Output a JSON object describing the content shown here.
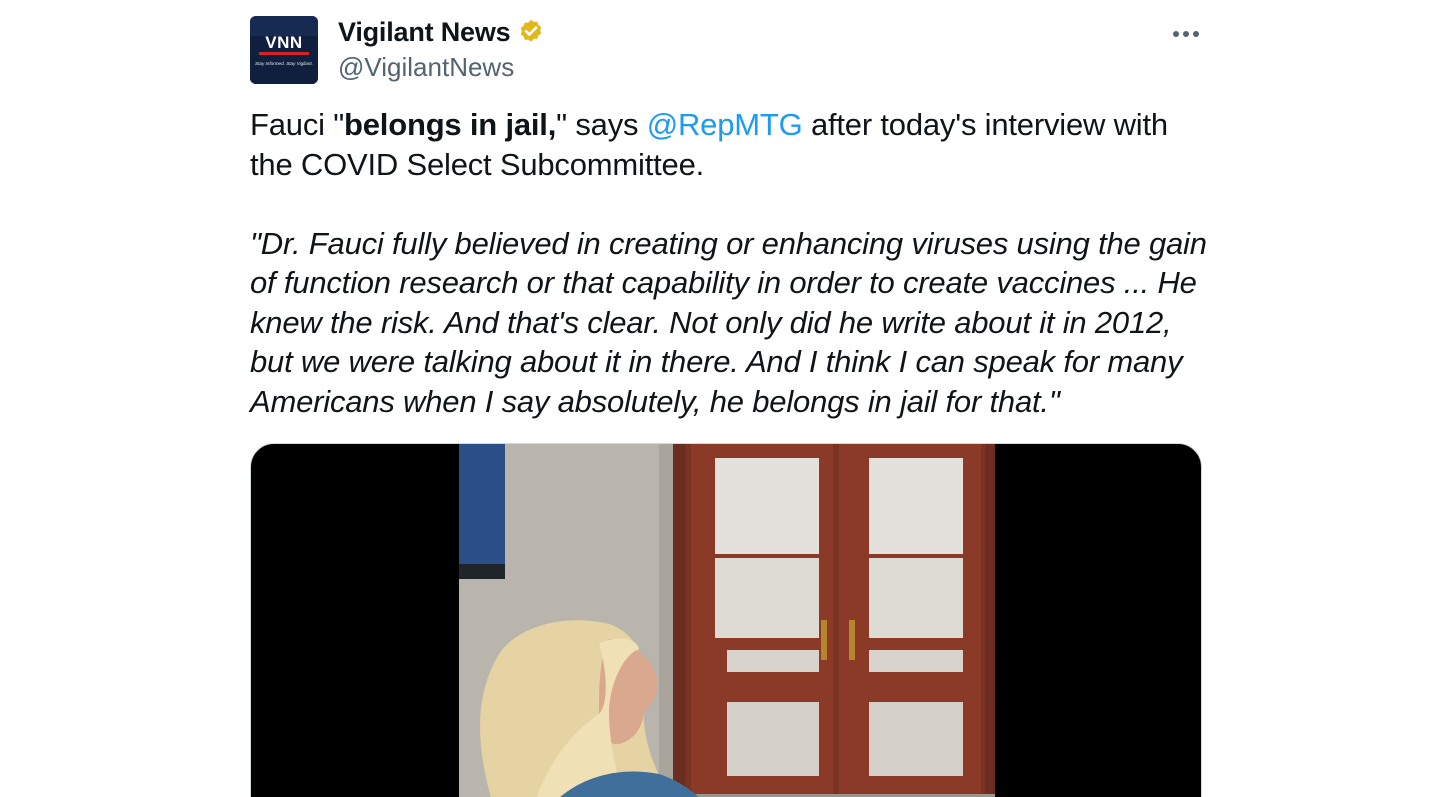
{
  "tweet": {
    "author": {
      "display_name": "Vigilant News",
      "handle": "@VigilantNews",
      "verified": true,
      "avatar_text": "VNN",
      "avatar_tagline": "Stay Informed. Stay Vigilant.",
      "badge_color": "#e2b719"
    },
    "text": {
      "segment_1": "Fauci \"",
      "segment_bold": "belongs in jail,",
      "segment_2": "\" says ",
      "mention": "@RepMTG",
      "segment_3": " after today's interview with the COVID Select Subcommittee.",
      "quote": "\"Dr. Fauci fully believed in creating or enhancing viruses using the gain of function research or that capability in order to create vaccines ... He knew the risk. And that's clear. Not only did he write about it in 2012, but we were talking about it in there. And I think I can speak for many Americans when I say absolutely, he belongs in jail for that.\""
    },
    "media": {
      "type": "video"
    }
  },
  "colors": {
    "mention": "#1d9bf0",
    "handle": "#536471",
    "text": "#0f1419"
  },
  "icons": {
    "more": "more-horizontal-icon",
    "verified": "verified-badge-icon"
  }
}
